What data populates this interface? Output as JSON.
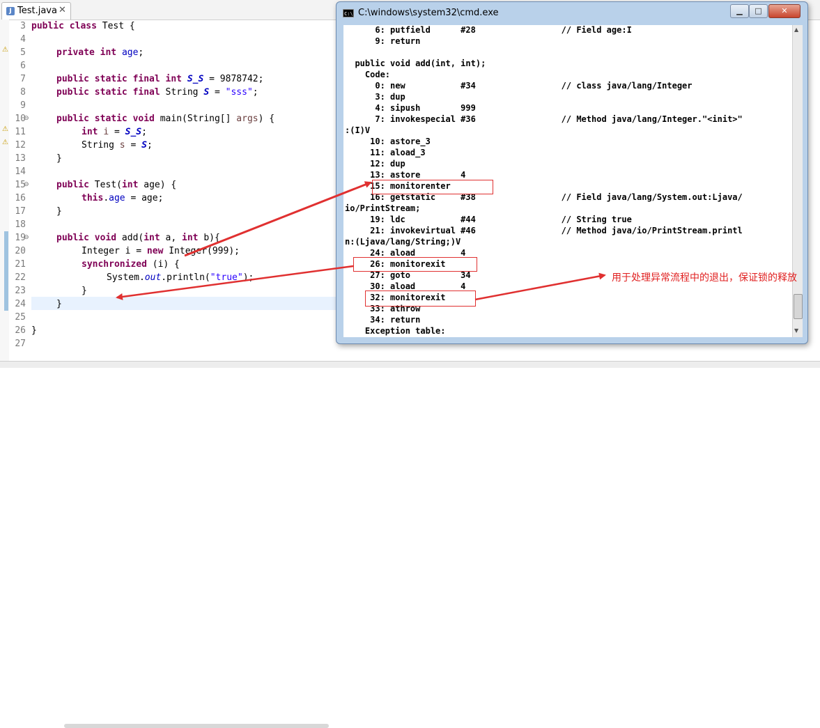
{
  "editor": {
    "tab_label": "Test.java",
    "tab_close": "✕",
    "line_numbers": [
      "3",
      "4",
      "5",
      "6",
      "7",
      "8",
      "9",
      "10",
      "11",
      "12",
      "13",
      "14",
      "15",
      "16",
      "17",
      "18",
      "19",
      "20",
      "21",
      "22",
      "23",
      "24",
      "25",
      "26",
      "27"
    ],
    "code": {
      "l3": {
        "kw": "public class",
        "rest": " Test {"
      },
      "l5": {
        "kw1": "private",
        "kw2": "int",
        "fld": "age",
        "end": ";"
      },
      "l7": {
        "kw": "public static final int",
        "sfld": "S_S",
        "rest": " = 9878742;"
      },
      "l8": {
        "kw": "public static final",
        "mid": " String ",
        "sfld": "S",
        "eq": " = ",
        "str": "\"sss\"",
        "end": ";"
      },
      "l10": {
        "kw": "public static void",
        "rest": " main(String[] ",
        "lv": "args",
        "end": ") {"
      },
      "l11": {
        "kw": "int",
        "lv": "i",
        "eq": " = ",
        "sfld": "S_S",
        "end": ";"
      },
      "l12": {
        "mid": "String ",
        "lv": "s",
        "eq": " = ",
        "sfld": "S",
        "end": ";"
      },
      "l13": "}",
      "l15": {
        "kw": "public",
        "rest": " Test(",
        "kw2": "int",
        "rest2": " age) {"
      },
      "l16": {
        "kw": "this",
        "dot": ".",
        "fld": "age",
        "rest": " = age;"
      },
      "l17": "}",
      "l19": {
        "kw": "public void",
        "rest": " add(",
        "kw2": "int",
        "rest2": " a, ",
        "kw3": "int",
        "rest3": " b){"
      },
      "l20": {
        "rest": "Integer i = ",
        "kw": "new",
        "rest2": " Integer(999);"
      },
      "l21": {
        "kw": "synchronized",
        "rest": " (i) {"
      },
      "l22": {
        "rest": "System.",
        "ital": "out",
        "rest2": ".println(",
        "str": "\"true\"",
        "end": ");"
      },
      "l23": "}",
      "l24": "}",
      "l26": "}"
    }
  },
  "cmd": {
    "title": "C:\\windows\\system32\\cmd.exe",
    "icon_text": "C:\\",
    "buttons": {
      "minimize": "▁",
      "maximize": "□",
      "close": "✕"
    },
    "lines": [
      "      6: putfield      #28                 // Field age:I",
      "      9: return",
      "",
      "  public void add(int, int);",
      "    Code:",
      "      0: new           #34                 // class java/lang/Integer",
      "      3: dup",
      "      4: sipush        999",
      "      7: invokespecial #36                 // Method java/lang/Integer.\"<init>\"",
      ":(I)V",
      "     10: astore_3",
      "     11: aload_3",
      "     12: dup",
      "     13: astore        4",
      "     15: monitorenter",
      "     16: getstatic     #38                 // Field java/lang/System.out:Ljava/",
      "io/PrintStream;",
      "     19: ldc           #44                 // String true",
      "     21: invokevirtual #46                 // Method java/io/PrintStream.printl",
      "n:(Ljava/lang/String;)V",
      "     24: aload         4",
      "     26: monitorexit",
      "     27: goto          34",
      "     30: aload         4",
      "     32: monitorexit",
      "     33: athrow",
      "     34: return",
      "    Exception table:"
    ]
  },
  "annotation": {
    "note": "用于处理异常流程中的退出，保证锁的释放"
  },
  "colors": {
    "annotation_red": "#e03030",
    "keyword": "#7f0055",
    "field": "#0000c0",
    "string": "#2a00ff"
  }
}
